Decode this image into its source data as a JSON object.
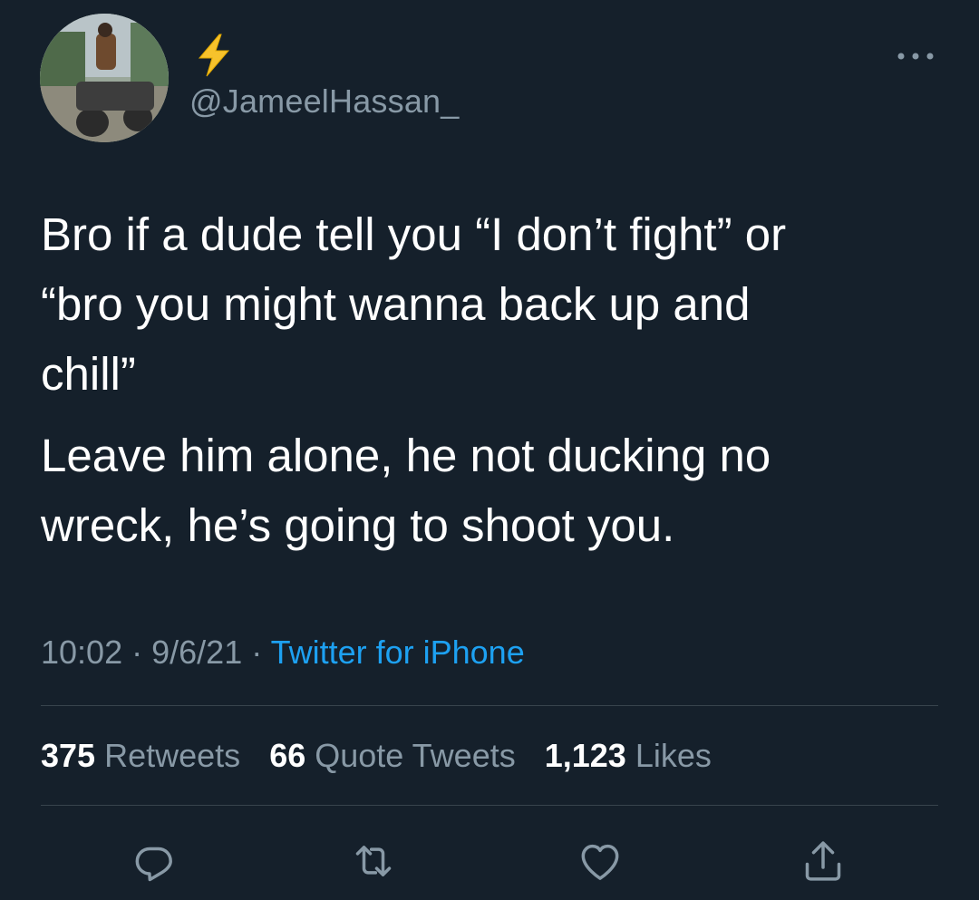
{
  "user": {
    "avatar": "avatar-photo",
    "name_emoji": "lightning-bolt-icon",
    "handle": "@JameelHassan_"
  },
  "tweet": {
    "lines_p1": [
      "Bro if a dude tell you “I don’t fight” or",
      "“bro you might wanna back up and",
      "chill”"
    ],
    "lines_p2": [
      "Leave him alone, he not ducking no",
      "wreck, he’s going to shoot you."
    ]
  },
  "meta": {
    "time": "10:02",
    "date": "9/6/21",
    "separator": "·",
    "source": "Twitter for iPhone"
  },
  "stats": {
    "retweets_count": "375",
    "retweets_label": "Retweets",
    "quotes_count": "66",
    "quotes_label": "Quote Tweets",
    "likes_count": "1,123",
    "likes_label": "Likes"
  },
  "actions": [
    "reply-icon",
    "retweet-icon",
    "like-icon",
    "share-icon"
  ],
  "colors": {
    "background": "#15202b",
    "text": "#ffffff",
    "secondary": "#8899a6",
    "link": "#1da1f2",
    "divider": "#38444d",
    "emoji": "#f7c22c"
  }
}
